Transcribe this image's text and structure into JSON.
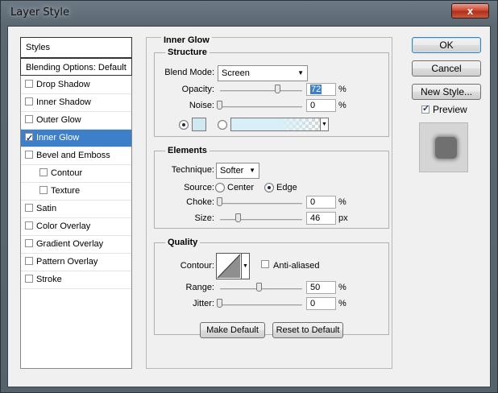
{
  "window": {
    "title": "Layer Style",
    "close_label": "x"
  },
  "styles_list": {
    "header": "Styles",
    "blending_options": "Blending Options: Default",
    "items": [
      {
        "label": "Drop Shadow",
        "checked": false,
        "indent": false
      },
      {
        "label": "Inner Shadow",
        "checked": false,
        "indent": false
      },
      {
        "label": "Outer Glow",
        "checked": false,
        "indent": false
      },
      {
        "label": "Inner Glow",
        "checked": true,
        "indent": false,
        "selected": true
      },
      {
        "label": "Bevel and Emboss",
        "checked": false,
        "indent": false
      },
      {
        "label": "Contour",
        "checked": false,
        "indent": true
      },
      {
        "label": "Texture",
        "checked": false,
        "indent": true
      },
      {
        "label": "Satin",
        "checked": false,
        "indent": false
      },
      {
        "label": "Color Overlay",
        "checked": false,
        "indent": false
      },
      {
        "label": "Gradient Overlay",
        "checked": false,
        "indent": false
      },
      {
        "label": "Pattern Overlay",
        "checked": false,
        "indent": false
      },
      {
        "label": "Stroke",
        "checked": false,
        "indent": false
      }
    ]
  },
  "panel": {
    "title": "Inner Glow",
    "structure": {
      "title": "Structure",
      "blend_mode_label": "Blend Mode:",
      "blend_mode_value": "Screen",
      "opacity_label": "Opacity:",
      "opacity_value": "72",
      "opacity_unit": "%",
      "noise_label": "Noise:",
      "noise_value": "0",
      "noise_unit": "%",
      "glow_color": "#cfe8f2"
    },
    "elements": {
      "title": "Elements",
      "technique_label": "Technique:",
      "technique_value": "Softer",
      "source_label": "Source:",
      "source_center": "Center",
      "source_edge": "Edge",
      "choke_label": "Choke:",
      "choke_value": "0",
      "choke_unit": "%",
      "size_label": "Size:",
      "size_value": "46",
      "size_unit": "px"
    },
    "quality": {
      "title": "Quality",
      "contour_label": "Contour:",
      "anti_aliased_label": "Anti-aliased",
      "range_label": "Range:",
      "range_value": "50",
      "range_unit": "%",
      "jitter_label": "Jitter:",
      "jitter_value": "0",
      "jitter_unit": "%"
    },
    "make_default": "Make Default",
    "reset_default": "Reset to Default"
  },
  "buttons": {
    "ok": "OK",
    "cancel": "Cancel",
    "new_style": "New Style...",
    "preview_label": "Preview"
  },
  "colors": {
    "selection": "#3d80c9",
    "dialog_bg": "#f0f0f0"
  }
}
